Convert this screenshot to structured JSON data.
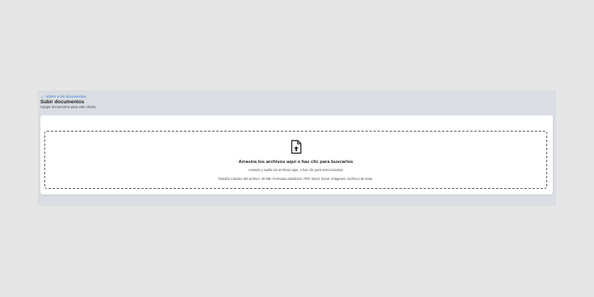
{
  "header": {
    "back_link_label": "Volver a los documentos",
    "back_icon": "arrow-left-icon",
    "title": "Subir documentos",
    "subtitle": "Cargar documentos para este cliente"
  },
  "dropzone": {
    "icon": "file-upload-icon",
    "title": "Arrastra los archivos aquí o haz clic para buscarlos",
    "subtitle": "Arrastra y suelta los archivos aquí, o haz clic para seleccionarlos",
    "info": "Tamaño máximo del archivo: 20 MB. Formatos admitidos: PDF, Word, Excel, imágenes, archivos de texto."
  },
  "colors": {
    "link": "#3b7ddd",
    "panel_bg": "#dadde1",
    "page_bg": "#e6e6e6",
    "card_bg": "#ffffff",
    "text_dark": "#1f2328"
  }
}
